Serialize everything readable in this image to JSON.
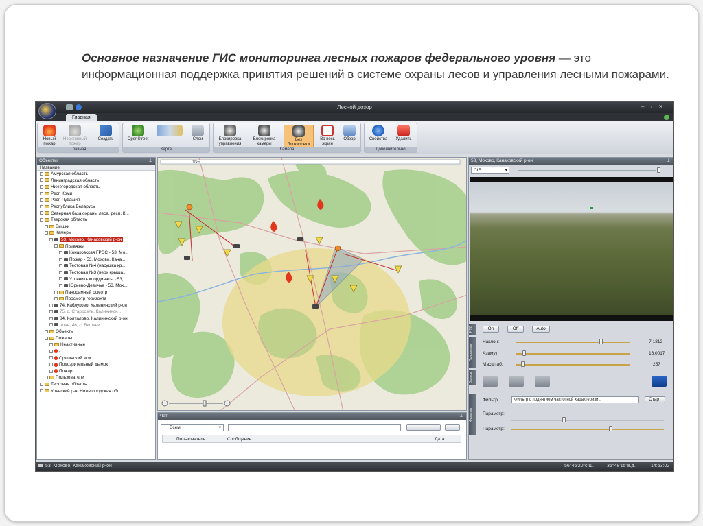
{
  "slide": {
    "heading_bold": "Основное назначение ГИС мониторинга лесных пожаров федерального уровня",
    "heading_rest": " — это информационная поддержка принятия решений в системе охраны лесов и управления лесными пожарами."
  },
  "app": {
    "window_title": "Лесной дозор",
    "tab_main": "Главная",
    "ribbon": {
      "groups": {
        "main": "Главная",
        "map": "Карта",
        "camera": "Камера",
        "extra": "Дополнительно"
      },
      "new_fire": "Новый пожар",
      "inactive_fire": "Неактивный пожар",
      "create": "Создать",
      "openstreet": "OpenStreet",
      "layers": "Слои",
      "block_control": "Блокировка управления",
      "block_cameras": "Блокировка камеры",
      "no_block": "Без блокировки",
      "full_screen": "Во весь экран",
      "overview": "Обзор",
      "properties": "Свойства",
      "delete": "Удалить"
    },
    "objects_panel": {
      "title": "Объекты",
      "column": "Название",
      "nodes": [
        {
          "text": "Амурская область",
          "lvl": 0,
          "kind": "region"
        },
        {
          "text": "Ленинградская область",
          "lvl": 0,
          "kind": "region"
        },
        {
          "text": "Нижегородская область",
          "lvl": 0,
          "kind": "region"
        },
        {
          "text": "Респ Коми",
          "lvl": 0,
          "kind": "region"
        },
        {
          "text": "Респ Чувашия",
          "lvl": 0,
          "kind": "region"
        },
        {
          "text": "Республика Беларусь",
          "lvl": 0,
          "kind": "region"
        },
        {
          "text": "Северная база охраны леса, респ. К...",
          "lvl": 0,
          "kind": "region"
        },
        {
          "text": "Тверская область",
          "lvl": 0,
          "kind": "region"
        },
        {
          "text": "Вышки",
          "lvl": 1,
          "kind": "folder"
        },
        {
          "text": "Камеры",
          "lvl": 1,
          "kind": "folder"
        },
        {
          "text": "53, Мохово, Канаковский р-он",
          "lvl": 2,
          "kind": "camera",
          "selected": true
        },
        {
          "text": "Привязки",
          "lvl": 3,
          "kind": "folder"
        },
        {
          "text": "Конаковская ГРЭС - 53, Мо...",
          "lvl": 4,
          "kind": "camera"
        },
        {
          "text": "Пожар - 53, Мохово, Кана...",
          "lvl": 4,
          "kind": "camera"
        },
        {
          "text": "Тестовая №4 (насушка кр...",
          "lvl": 4,
          "kind": "camera"
        },
        {
          "text": "Тестовая №3 (верх крыша...",
          "lvl": 4,
          "kind": "camera"
        },
        {
          "text": "Уточнить координаты - 53,...",
          "lvl": 4,
          "kind": "camera"
        },
        {
          "text": "Юрьево-Девичье - 53, Мох...",
          "lvl": 4,
          "kind": "camera"
        },
        {
          "text": "Панорамный осмотр",
          "lvl": 3,
          "kind": "folder"
        },
        {
          "text": "Просмотр горизонта",
          "lvl": 3,
          "kind": "folder"
        },
        {
          "text": "74, Каблуково, Калининский р-он",
          "lvl": 2,
          "kind": "camera"
        },
        {
          "text": "75, с. Старосель, Калининск...",
          "lvl": 2,
          "kind": "camera-dim"
        },
        {
          "text": "84, Колталово, Калининский р-он",
          "lvl": 2,
          "kind": "camera"
        },
        {
          "text": "план, 46, с. Вишнеи",
          "lvl": 2,
          "kind": "camera-dim"
        },
        {
          "text": "Объекты",
          "lvl": 1,
          "kind": "folder"
        },
        {
          "text": "Пожары",
          "lvl": 1,
          "kind": "folder"
        },
        {
          "text": "Неактивные",
          "lvl": 2,
          "kind": "folder"
        },
        {
          "text": "-",
          "lvl": 2,
          "kind": "fire"
        },
        {
          "text": "Оршинский мох",
          "lvl": 2,
          "kind": "fire"
        },
        {
          "text": "Подозрительный дымок",
          "lvl": 2,
          "kind": "fire"
        },
        {
          "text": "Пожар",
          "lvl": 2,
          "kind": "fire"
        },
        {
          "text": "Пользователи",
          "lvl": 1,
          "kind": "folder"
        },
        {
          "text": "Тестовая область",
          "lvl": 0,
          "kind": "region"
        },
        {
          "text": "Уренский р-н, Нижегородская обл.",
          "lvl": 0,
          "kind": "region"
        }
      ]
    },
    "map": {
      "scale_label": "10km"
    },
    "chat": {
      "title": "Чат",
      "recipient": "Всем",
      "columns": [
        "Пользователь",
        "Сообщение",
        "Дата"
      ]
    },
    "video": {
      "title": "53, Мохово, Канаковский р-он",
      "resolution": "CIF",
      "on": "On",
      "off": "Off",
      "auto": "Auto",
      "tilt_label": "Наклон:",
      "tilt_value": "-7,1812",
      "azimuth_label": "Азимут:",
      "azimuth_value": "16,0017",
      "scale_label": "Масштаб:",
      "scale_value": "257",
      "filter_label": "Фильтр:",
      "filter_value": "Фильтр с поднятием частотной характеризи...",
      "start": "Старт",
      "param1": "Параметр:",
      "param2": "Параметр:",
      "side_tabs": [
        "PTZ",
        "Положение",
        "Запись",
        "Фильтры"
      ]
    },
    "status": {
      "camera": "53, Мохово, Канаковский р-он",
      "lat": "56°46'20\"с.ш.",
      "lon": "35°48'15\"в.д.",
      "time": "14:53:02"
    },
    "colors": {
      "fire": "#e2371c",
      "selected": "#c2261b",
      "accent": "#c7a44a"
    }
  }
}
